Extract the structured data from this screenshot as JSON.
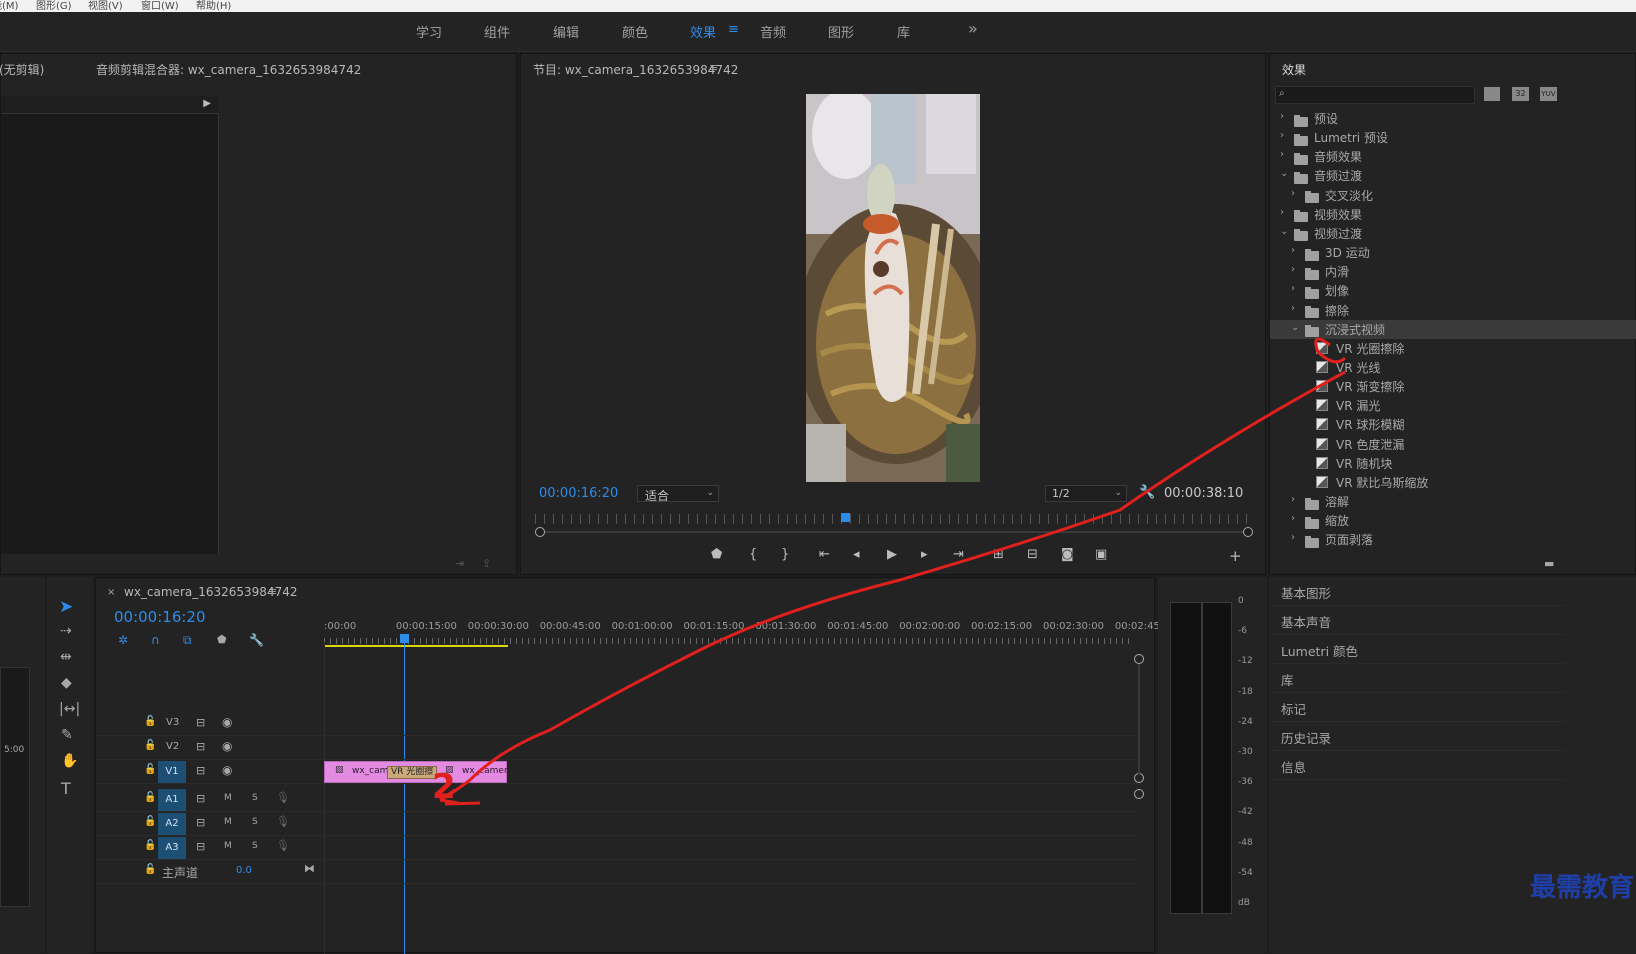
{
  "menubar": {
    "items": [
      "能(M)",
      "图形(G)",
      "视图(V)",
      "窗口(W)",
      "帮助(H)"
    ]
  },
  "workspaces": {
    "tabs": [
      "学习",
      "组件",
      "编辑",
      "颜色",
      "效果",
      "音频",
      "图形",
      "库"
    ],
    "active": "效果",
    "more": "»",
    "menu": "≡"
  },
  "source_panel": {
    "title1": "(无剪辑)",
    "title2": "音频剪辑混合器: wx_camera_1632653984742"
  },
  "program_monitor": {
    "title": "节目: wx_camera_1632653984742",
    "timecode": "00:00:16:20",
    "fit": "适合",
    "resolution": "1/2",
    "duration": "00:00:38:10"
  },
  "effects": {
    "title": "效果",
    "search_placeholder": "",
    "badges": [
      "32",
      "YUV"
    ],
    "tree": [
      {
        "label": "预设",
        "level": 0,
        "type": "preset",
        "open": false
      },
      {
        "label": "Lumetri 预设",
        "level": 0,
        "type": "preset",
        "open": false
      },
      {
        "label": "音频效果",
        "level": 0,
        "type": "folder",
        "open": false
      },
      {
        "label": "音频过渡",
        "level": 0,
        "type": "folder",
        "open": true
      },
      {
        "label": "交叉淡化",
        "level": 1,
        "type": "folder",
        "open": false
      },
      {
        "label": "视频效果",
        "level": 0,
        "type": "folder",
        "open": false
      },
      {
        "label": "视频过渡",
        "level": 0,
        "type": "folder",
        "open": true
      },
      {
        "label": "3D 运动",
        "level": 1,
        "type": "folder",
        "open": false
      },
      {
        "label": "内滑",
        "level": 1,
        "type": "folder",
        "open": false
      },
      {
        "label": "划像",
        "level": 1,
        "type": "folder",
        "open": false
      },
      {
        "label": "擦除",
        "level": 1,
        "type": "folder",
        "open": false
      },
      {
        "label": "沉浸式视频",
        "level": 1,
        "type": "folder",
        "open": true,
        "selected": true
      },
      {
        "label": "VR 光圈擦除",
        "level": 2,
        "type": "effect"
      },
      {
        "label": "VR 光线",
        "level": 2,
        "type": "effect"
      },
      {
        "label": "VR 渐变擦除",
        "level": 2,
        "type": "effect"
      },
      {
        "label": "VR 漏光",
        "level": 2,
        "type": "effect"
      },
      {
        "label": "VR 球形模糊",
        "level": 2,
        "type": "effect"
      },
      {
        "label": "VR 色度泄漏",
        "level": 2,
        "type": "effect"
      },
      {
        "label": "VR 随机块",
        "level": 2,
        "type": "effect"
      },
      {
        "label": "VR 默比乌斯缩放",
        "level": 2,
        "type": "effect"
      },
      {
        "label": "溶解",
        "level": 1,
        "type": "folder",
        "open": false
      },
      {
        "label": "缩放",
        "level": 1,
        "type": "folder",
        "open": false
      },
      {
        "label": "页面剥落",
        "level": 1,
        "type": "folder",
        "open": false
      }
    ]
  },
  "side_panels": [
    "基本图形",
    "基本声音",
    "Lumetri 颜色",
    "库",
    "标记",
    "历史记录",
    "信息"
  ],
  "timeline": {
    "sequence_name": "wx_camera_1632653984742",
    "timecode": "00:00:16:20",
    "ruler": [
      ":00:00",
      "00:00:15:00",
      "00:00:30:00",
      "00:00:45:00",
      "00:01:00:00",
      "00:01:15:00",
      "00:01:30:00",
      "00:01:45:00",
      "00:02:00:00",
      "00:02:15:00",
      "00:02:30:00",
      "00:02:45:"
    ],
    "video_tracks": [
      "V3",
      "V2",
      "V1"
    ],
    "audio_tracks": [
      "A1",
      "A2",
      "A3"
    ],
    "audio_ms": [
      "M",
      "S"
    ],
    "master_label": "主声道",
    "master_value": "0.0",
    "clip_left": "wx_cam",
    "clip_right": "wx_camer",
    "transition_label": "VR 光圈擦",
    "annotation_number": "2",
    "left_edge_label": "5:00"
  },
  "meter": {
    "scale": [
      "0",
      "-6",
      "-12",
      "-18",
      "-24",
      "-30",
      "-36",
      "-42",
      "-48",
      "-54",
      "dB"
    ]
  },
  "watermark": "最需教育",
  "colors": {
    "accent": "#2d8ceb",
    "clip": "#e38ae3",
    "annotation": "#e0201d",
    "track_btn": "#1c4f73"
  }
}
